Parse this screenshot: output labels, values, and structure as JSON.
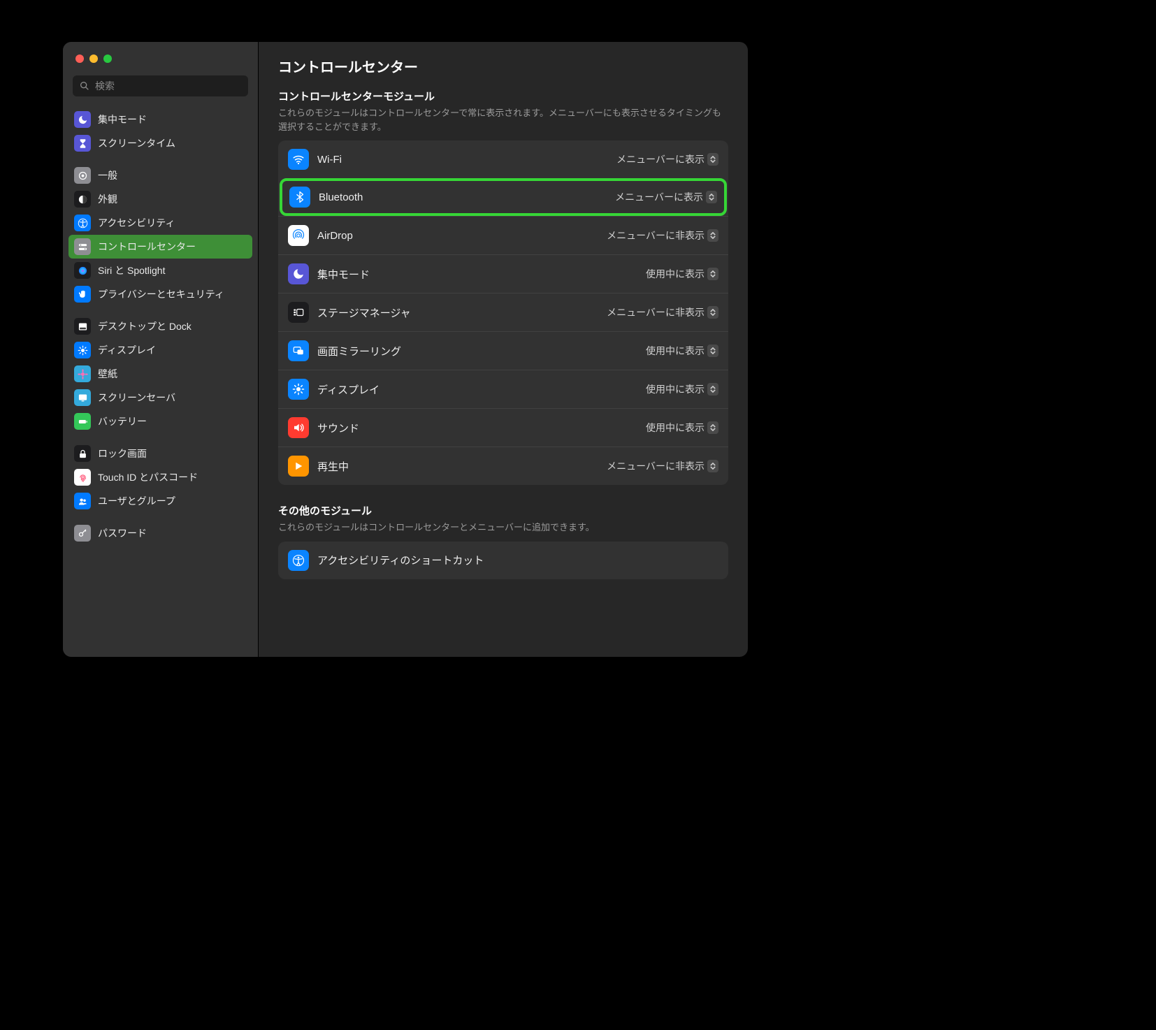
{
  "page_title": "コントロールセンター",
  "search": {
    "placeholder": "検索"
  },
  "sidebar": {
    "groups": [
      [
        {
          "label": "集中モード",
          "icon": "moon",
          "bg": "#5856d6"
        },
        {
          "label": "スクリーンタイム",
          "icon": "hourglass",
          "bg": "#5856d6"
        }
      ],
      [
        {
          "label": "一般",
          "icon": "gear",
          "bg": "#8e8e93"
        },
        {
          "label": "外観",
          "icon": "appearance",
          "bg": "#1c1c1e"
        },
        {
          "label": "アクセシビリティ",
          "icon": "accessibility",
          "bg": "#007aff"
        },
        {
          "label": "コントロールセンター",
          "icon": "toggles",
          "bg": "#8e8e93",
          "selected": true
        },
        {
          "label": "Siri と Spotlight",
          "icon": "siri",
          "bg": "#1c1c1e"
        },
        {
          "label": "プライバシーとセキュリティ",
          "icon": "hand",
          "bg": "#007aff"
        }
      ],
      [
        {
          "label": "デスクトップと Dock",
          "icon": "dock",
          "bg": "#1c1c1e"
        },
        {
          "label": "ディスプレイ",
          "icon": "brightness",
          "bg": "#007aff"
        },
        {
          "label": "壁紙",
          "icon": "wallpaper",
          "bg": "#34aadc"
        },
        {
          "label": "スクリーンセーバ",
          "icon": "screensaver",
          "bg": "#34aadc"
        },
        {
          "label": "バッテリー",
          "icon": "battery",
          "bg": "#34c759"
        }
      ],
      [
        {
          "label": "ロック画面",
          "icon": "lock",
          "bg": "#1c1c1e"
        },
        {
          "label": "Touch ID とパスコード",
          "icon": "fingerprint",
          "bg": "#ffffff"
        },
        {
          "label": "ユーザとグループ",
          "icon": "users",
          "bg": "#007aff"
        }
      ],
      [
        {
          "label": "パスワード",
          "icon": "key",
          "bg": "#8e8e93"
        }
      ]
    ]
  },
  "sections": [
    {
      "title": "コントロールセンターモジュール",
      "subtitle": "これらのモジュールはコントロールセンターで常に表示されます。メニューバーにも表示させるタイミングも選択することができます。",
      "modules": [
        {
          "label": "Wi-Fi",
          "icon": "wifi",
          "bg": "#0a84ff",
          "value": "メニューバーに表示"
        },
        {
          "label": "Bluetooth",
          "icon": "bluetooth",
          "bg": "#0a84ff",
          "value": "メニューバーに表示",
          "highlighted": true
        },
        {
          "label": "AirDrop",
          "icon": "airdrop",
          "bg": "#ffffff",
          "value": "メニューバーに非表示"
        },
        {
          "label": "集中モード",
          "icon": "moon",
          "bg": "#5856d6",
          "value": "使用中に表示"
        },
        {
          "label": "ステージマネージャ",
          "icon": "stage",
          "bg": "#1c1c1e",
          "value": "メニューバーに非表示"
        },
        {
          "label": "画面ミラーリング",
          "icon": "mirror",
          "bg": "#0a84ff",
          "value": "使用中に表示"
        },
        {
          "label": "ディスプレイ",
          "icon": "brightness",
          "bg": "#0a84ff",
          "value": "使用中に表示"
        },
        {
          "label": "サウンド",
          "icon": "sound",
          "bg": "#ff3b30",
          "value": "使用中に表示"
        },
        {
          "label": "再生中",
          "icon": "play",
          "bg": "#ff9500",
          "value": "メニューバーに非表示"
        }
      ]
    },
    {
      "title": "その他のモジュール",
      "subtitle": "これらのモジュールはコントロールセンターとメニューバーに追加できます。",
      "modules": [
        {
          "label": "アクセシビリティのショートカット",
          "icon": "accessibility",
          "bg": "#0a84ff"
        }
      ]
    }
  ],
  "colors": {
    "highlight": "#36d636"
  }
}
